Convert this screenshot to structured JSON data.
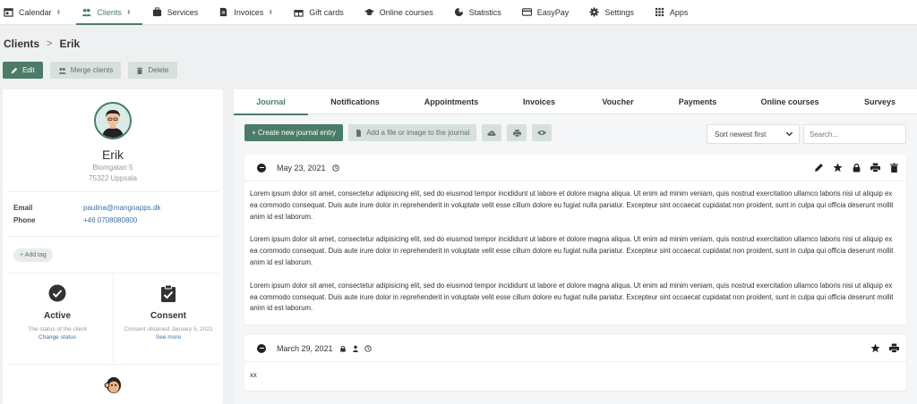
{
  "nav": {
    "items": [
      {
        "label": "Calendar",
        "icon": "calendar-icon",
        "updown": "⬍"
      },
      {
        "label": "Clients",
        "icon": "clients-icon",
        "updown": "⬍",
        "active": true
      },
      {
        "label": "Services",
        "icon": "services-icon"
      },
      {
        "label": "Invoices",
        "icon": "invoice-icon",
        "updown": "⬍"
      },
      {
        "label": "Gift cards",
        "icon": "gift-icon"
      },
      {
        "label": "Online courses",
        "icon": "graduation-icon"
      },
      {
        "label": "Statistics",
        "icon": "pie-chart-icon"
      },
      {
        "label": "EasyPay",
        "icon": "credit-card-icon"
      },
      {
        "label": "Settings",
        "icon": "gear-icon"
      },
      {
        "label": "Apps",
        "icon": "grid-icon"
      }
    ]
  },
  "breadcrumb": {
    "parent": "Clients",
    "separator": ">",
    "current": "Erik"
  },
  "actions": {
    "edit": "Edit",
    "merge": "Merge clients",
    "delete": "Delete"
  },
  "profile": {
    "name": "Erik",
    "address_line1": "Blomgatan 5",
    "address_line2": "75322 Uppsala",
    "email_label": "Email",
    "email": "paulina@mangoapps.dk",
    "phone_label": "Phone",
    "phone": "+46 0708080800",
    "add_tag": "+ Add tag",
    "status": {
      "title": "Active",
      "sub": "The status of the client",
      "link": "Change status"
    },
    "consent": {
      "title": "Consent",
      "sub": "Consent obtained January 5, 2021",
      "link": "See more"
    }
  },
  "tabs": [
    "Journal",
    "Notifications",
    "Appointments",
    "Invoices",
    "Voucher",
    "Payments",
    "Online courses",
    "Surveys"
  ],
  "toolbar": {
    "create": "+ Create new journal entry",
    "add_file": "Add a file or image to the journal",
    "sort_value": "Sort newest first",
    "search_placeholder": "Search..."
  },
  "entries": [
    {
      "date": "May 23, 2021",
      "paragraphs": [
        "Lorem ipsum dolor sit amet, consectetur adipisicing elit, sed do eiusmod tempor incididunt ut labore et dolore magna aliqua. Ut enim ad minim veniam, quis nostrud exercitation ullamco laboris nisi ut aliquip ex ea commodo consequat. Duis aute irure dolor in reprehenderit in voluptate velit esse cillum dolore eu fugiat nulla pariatur. Excepteur sint occaecat cupidatat non proident, sunt in culpa qui officia deserunt mollit anim id est laborum.",
        "Lorem ipsum dolor sit amet, consectetur adipisicing elit, sed do eiusmod tempor incididunt ut labore et dolore magna aliqua. Ut enim ad minim veniam, quis nostrud exercitation ullamco laboris nisi ut aliquip ex ea commodo consequat. Duis aute irure dolor in reprehenderit in voluptate velit esse cillum dolore eu fugiat nulla pariatur. Excepteur sint occaecat cupidatat non proident, sunt in culpa qui officia deserunt mollit anim id est laborum.",
        "Lorem ipsum dolor sit amet, consectetur adipisicing elit, sed do eiusmod tempor incididunt ut labore et dolore magna aliqua. Ut enim ad minim veniam, quis nostrud exercitation ullamco laboris nisi ut aliquip ex ea commodo consequat. Duis aute irure dolor in reprehenderit in voluptate velit esse cillum dolore eu fugiat nulla pariatur. Excepteur sint occaecat cupidatat non proident, sunt in culpa qui officia deserunt mollit anim id est laborum."
      ]
    },
    {
      "date": "March 29, 2021",
      "body": "xx"
    }
  ],
  "colors": {
    "accent": "#4a7c68",
    "soft": "#d7e0dc",
    "link": "#3b6fa8"
  }
}
